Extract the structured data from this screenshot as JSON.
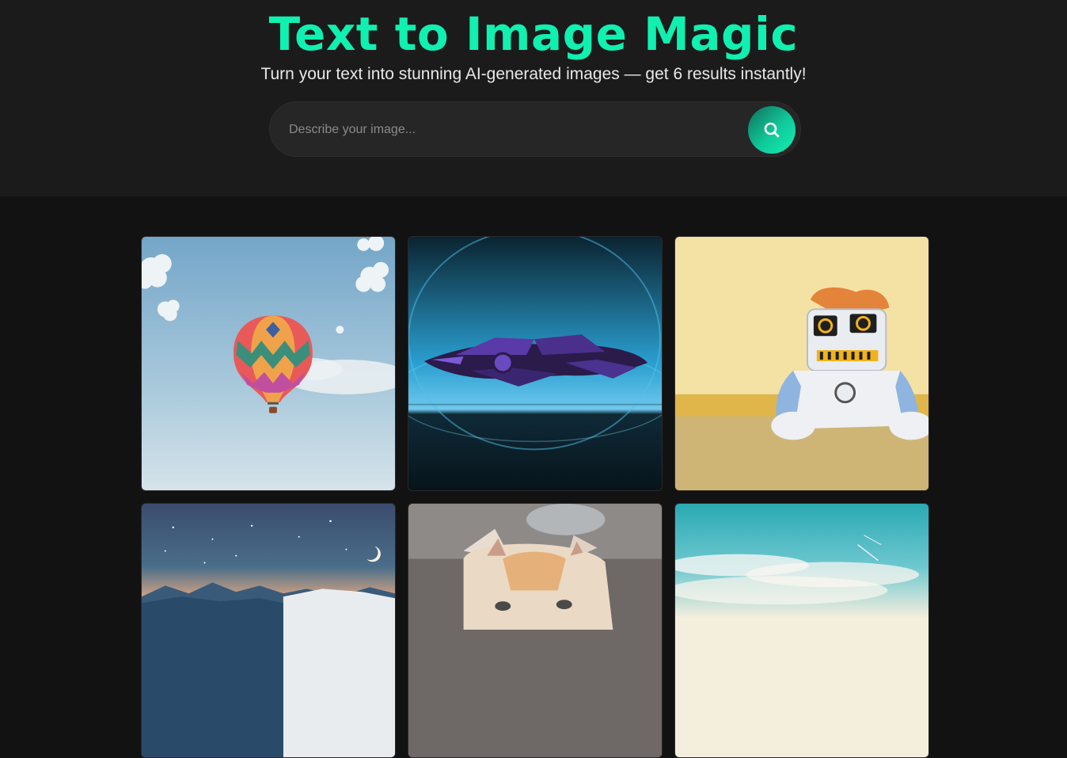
{
  "header": {
    "title": "Text to Image Magic",
    "subtitle": "Turn your text into stunning AI-generated images — get 6 results instantly!"
  },
  "search": {
    "placeholder": "Describe your image...",
    "value": "",
    "button_icon": "search-icon"
  },
  "gallery": {
    "images": [
      {
        "name": "hot-air-balloon-image",
        "subject": "hot air balloon"
      },
      {
        "name": "spaceship-image",
        "subject": "spaceship"
      },
      {
        "name": "robot-plush-image",
        "subject": "robot plush toy"
      },
      {
        "name": "night-mountains-image",
        "subject": "night mountains"
      },
      {
        "name": "cat-image",
        "subject": "cat"
      },
      {
        "name": "sky-image",
        "subject": "sky"
      }
    ]
  },
  "colors": {
    "accent": "#10f0b0",
    "header_bg": "#1b1b1b",
    "page_bg": "#121212",
    "search_bg": "#262626"
  }
}
